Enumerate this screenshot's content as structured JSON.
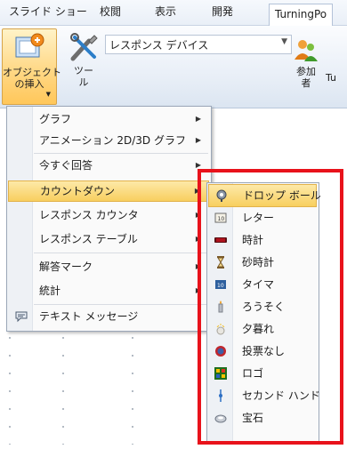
{
  "tabs": [
    "スライド ショー",
    "校閲",
    "表示",
    "開発",
    "TurningPo"
  ],
  "ribbon": {
    "insert_object_label": "オブジェクト\nの挿入",
    "tools_label": "ツー\nル",
    "device_combo_value": "レスポンス デバイス",
    "participants_label": "参加\n者",
    "turning_label": "Tu"
  },
  "menu": {
    "items": [
      {
        "label": "グラフ",
        "submenu": true
      },
      {
        "label": "アニメーション 2D/3D グラフ",
        "submenu": true
      },
      {
        "label": "今すぐ回答",
        "submenu": true
      },
      {
        "label": "カウントダウン",
        "submenu": true,
        "highlighted": true
      },
      {
        "label": "レスポンス カウンタ",
        "submenu": true
      },
      {
        "label": "レスポンス テーブル",
        "submenu": true
      },
      {
        "label": "解答マーク",
        "submenu": true
      },
      {
        "label": "統計",
        "submenu": true
      },
      {
        "label": "テキスト メッセージ",
        "submenu": false
      }
    ]
  },
  "submenu": {
    "items": [
      {
        "label": "ドロップ ボール",
        "icon": "drop-ball-icon",
        "highlighted": true
      },
      {
        "label": "レター",
        "icon": "letter-icon"
      },
      {
        "label": "時計",
        "icon": "clock-icon"
      },
      {
        "label": "砂時計",
        "icon": "hourglass-icon"
      },
      {
        "label": "タイマ",
        "icon": "timer-icon"
      },
      {
        "label": "ろうそく",
        "icon": "candle-icon"
      },
      {
        "label": "夕暮れ",
        "icon": "dusk-icon"
      },
      {
        "label": "投票なし",
        "icon": "no-vote-icon"
      },
      {
        "label": "ロゴ",
        "icon": "logo-icon"
      },
      {
        "label": "セカンド ハンド",
        "icon": "second-hand-icon"
      },
      {
        "label": "宝石",
        "icon": "gem-icon"
      }
    ]
  },
  "colors": {
    "highlight": "#f8cf5f",
    "annotation_box": "#e8121b"
  }
}
